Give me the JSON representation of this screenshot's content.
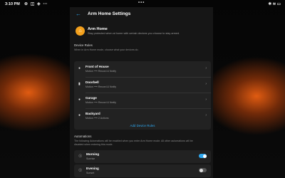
{
  "status_bar": {
    "time": "3:10 PM",
    "app_icons": "⊕ ◫ ◈ ⋯",
    "right_icons": "✱ ≋ ▭",
    "dots": "•••"
  },
  "header": {
    "title": "Arm Home Settings",
    "back_icon": "arrow-left-icon"
  },
  "hero": {
    "title": "Arm Home",
    "description": "Stay protected when at home with certain devices you choose to stay armed.",
    "icon": "home-shield-icon"
  },
  "device_rules": {
    "title": "Device Rules",
    "subtitle": "When in Arm Home mode, choose what your devices do.",
    "items": [
      {
        "name": "Front of House",
        "description": "Motion ⟶ Record & Notify"
      },
      {
        "name": "Doorbell",
        "description": "Motion ⟶ Record & Notify"
      },
      {
        "name": "Garage",
        "description": "Motion ⟶ Record & Notify"
      },
      {
        "name": "Backyard",
        "description": "Motion ⟶ 2 Actions"
      }
    ],
    "add_label": "Add Device Rules"
  },
  "automations": {
    "title": "Automations",
    "subtitle_line1": "The following Automations will be enabled when you enter Arm Home mode. All other automations will be",
    "subtitle_line2": "disabled when entering this mode.",
    "items": [
      {
        "name": "Morning",
        "description": "Sunrise",
        "enabled": true
      },
      {
        "name": "Evening",
        "description": "Sunset",
        "enabled": false
      }
    ]
  },
  "colors": {
    "accent": "#2ea8f0",
    "hero_icon": "#f4a11d",
    "background_glow": "#ec6012"
  }
}
